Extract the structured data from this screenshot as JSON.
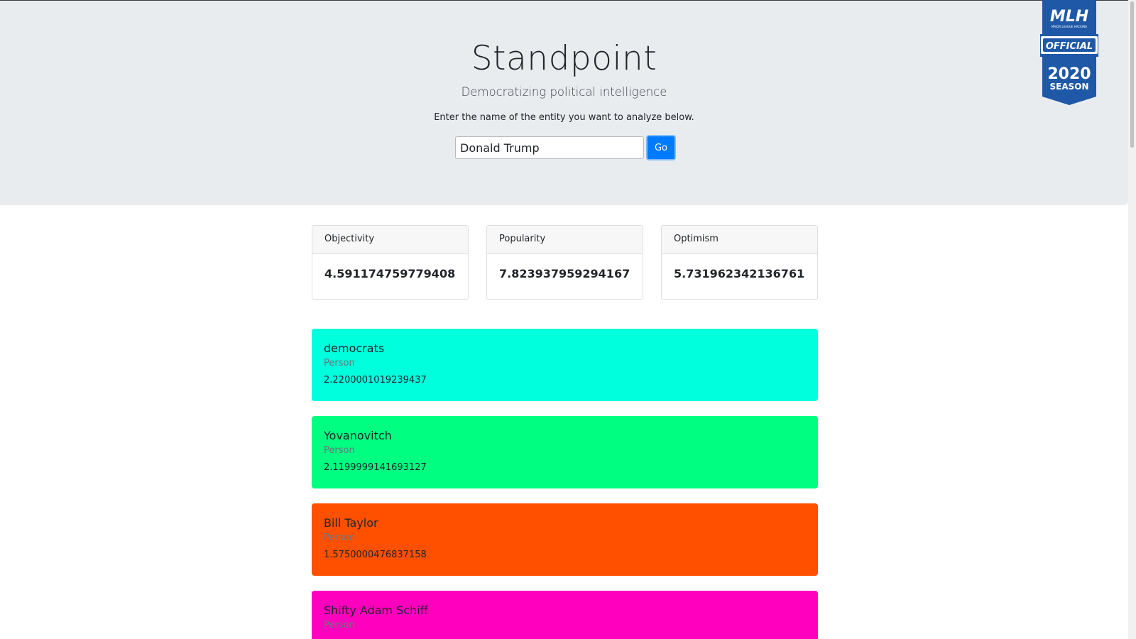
{
  "header": {
    "title": "Standpoint",
    "subtitle": "Democratizing political intelligence",
    "instructions": "Enter the name of the entity you want to analyze below."
  },
  "search": {
    "value": "Donald Trump",
    "button_label": "Go"
  },
  "mlh_banner": {
    "line1": "MLH",
    "line2": "MAJOR LEAGUE HACKING",
    "line3": "OFFICIAL",
    "line4": "2020",
    "line5": "SEASON"
  },
  "scores": [
    {
      "label": "Objectivity",
      "value": "4.591174759779408"
    },
    {
      "label": "Popularity",
      "value": "7.823937959294167"
    },
    {
      "label": "Optimism",
      "value": "5.731962342136761"
    }
  ],
  "entities": [
    {
      "name": "democrats",
      "type": "Person",
      "score": "2.2200001019239437",
      "color": "#00ffdd"
    },
    {
      "name": "Yovanovitch",
      "type": "Person",
      "score": "2.1199999141693127",
      "color": "#00ff80"
    },
    {
      "name": "Bill Taylor",
      "type": "Person",
      "score": "1.5750000476837158",
      "color": "#ff5000"
    },
    {
      "name": "Shifty Adam Schiff",
      "type": "Person",
      "score": "",
      "color": "#ff00bf"
    }
  ]
}
